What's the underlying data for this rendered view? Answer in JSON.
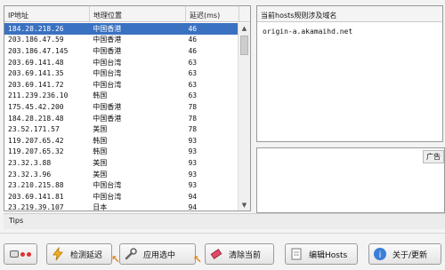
{
  "ip_table": {
    "columns": [
      "IP地址",
      "地理位置",
      "延迟(ms)"
    ],
    "selected_row": 0,
    "rows": [
      [
        "184.28.218.26",
        "中国香港",
        "46"
      ],
      [
        "203.186.47.59",
        "中国香港",
        "46"
      ],
      [
        "203.186.47.145",
        "中国香港",
        "46"
      ],
      [
        "203.69.141.48",
        "中国台湾",
        "63"
      ],
      [
        "203.69.141.35",
        "中国台湾",
        "63"
      ],
      [
        "203.69.141.72",
        "中国台湾",
        "63"
      ],
      [
        "211.239.236.10",
        "韩国",
        "63"
      ],
      [
        "175.45.42.200",
        "中国香港",
        "78"
      ],
      [
        "184.28.218.48",
        "中国香港",
        "78"
      ],
      [
        "23.52.171.57",
        "美国",
        "78"
      ],
      [
        "119.207.65.42",
        "韩国",
        "93"
      ],
      [
        "119.207.65.32",
        "韩国",
        "93"
      ],
      [
        "23.32.3.88",
        "美国",
        "93"
      ],
      [
        "23.32.3.96",
        "美国",
        "93"
      ],
      [
        "23.210.215.88",
        "中国台湾",
        "93"
      ],
      [
        "203.69.141.81",
        "中国台湾",
        "94"
      ],
      [
        "23.219.39.107",
        "日本",
        "94"
      ]
    ]
  },
  "hosts_panel": {
    "header": "当前hosts规则涉及域名",
    "entries": [
      "origin-a.akamaihd.net"
    ]
  },
  "ad_panel": {
    "label": "广告"
  },
  "tips": {
    "label": "Tips"
  },
  "toolbar": {
    "test_label": "检测延迟",
    "apply_label": "应用选中",
    "clear_label": "清除当前",
    "edit_label": "编辑Hosts",
    "about_label": "关于/更新"
  },
  "colors": {
    "selection": "#3a71c1",
    "accent_arrow": "#e08a1e"
  }
}
